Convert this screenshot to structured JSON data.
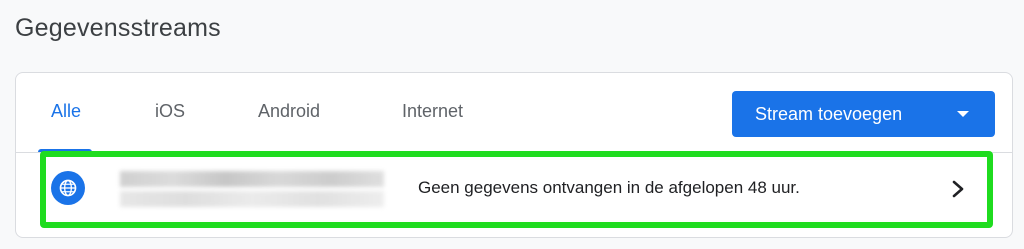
{
  "page": {
    "title": "Gegevensstreams"
  },
  "tabs": [
    {
      "label": "Alle",
      "active": true
    },
    {
      "label": "iOS",
      "active": false
    },
    {
      "label": "Android",
      "active": false
    },
    {
      "label": "Internet",
      "active": false
    }
  ],
  "toolbar": {
    "add_stream_label": "Stream toevoegen",
    "add_stream_icon": "dropdown-caret-icon"
  },
  "streams": [
    {
      "platform_icon": "globe-icon",
      "status": "Geen gegevens ontvangen in de afgelopen 48 uur.",
      "action_icon": "chevron-right-icon"
    }
  ],
  "colors": {
    "accent": "#1a73e8",
    "highlight": "#1fdc1f",
    "text": "#3c4043",
    "muted": "#5f6368",
    "border": "#dadce0"
  }
}
